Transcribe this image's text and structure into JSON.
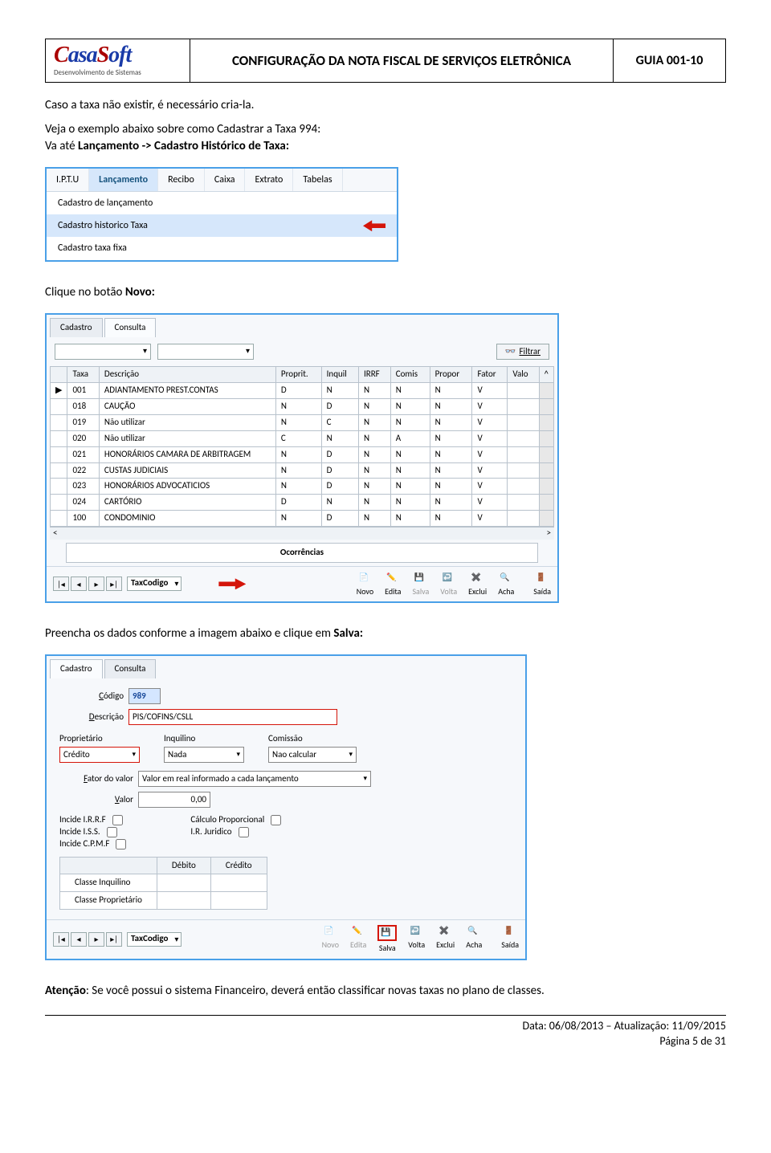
{
  "header": {
    "logo_text": "CasaSoft",
    "logo_sub": "Desenvolvimento de Sistemas",
    "title": "CONFIGURAÇÃO DA NOTA FISCAL DE SERVIÇOS ELETRÔNICA",
    "code": "GUIA 001-10"
  },
  "p1": "Caso a taxa não existir, é necessário cria-la.",
  "p2a": "Veja o exemplo abaixo sobre como Cadastrar a Taxa 994:",
  "p2b_plain": "Va até ",
  "p2b_bold": "Lançamento -> Cadastro Histórico de Taxa:",
  "menu": {
    "items": [
      "I.P.T.U",
      "Lançamento",
      "Recibo",
      "Caixa",
      "Extrato",
      "Tabelas"
    ],
    "dropdown": [
      "Cadastro de lançamento",
      "Cadastro historico Taxa",
      "Cadastro taxa fixa"
    ]
  },
  "p3_plain": "Clique no botão ",
  "p3_bold": "Novo:",
  "tabs": {
    "cadastro": "Cadastro",
    "consulta": "Consulta"
  },
  "filter_btn": "Filtrar",
  "table": {
    "headers": [
      "Taxa",
      "Descrição",
      "Proprit.",
      "Inquil",
      "IRRF",
      "Comis",
      "Propor",
      "Fator",
      "Valo"
    ],
    "rows": [
      [
        "001",
        "ADIANTAMENTO PREST.CONTAS",
        "D",
        "N",
        "N",
        "N",
        "N",
        "V",
        ""
      ],
      [
        "018",
        "CAUÇÃO",
        "N",
        "D",
        "N",
        "N",
        "N",
        "V",
        ""
      ],
      [
        "019",
        "Não utilizar",
        "N",
        "C",
        "N",
        "N",
        "N",
        "V",
        ""
      ],
      [
        "020",
        "Não utilizar",
        "C",
        "N",
        "N",
        "A",
        "N",
        "V",
        ""
      ],
      [
        "021",
        "HONORÁRIOS CAMARA DE ARBITRAGEM",
        "N",
        "D",
        "N",
        "N",
        "N",
        "V",
        ""
      ],
      [
        "022",
        "CUSTAS JUDICIAIS",
        "N",
        "D",
        "N",
        "N",
        "N",
        "V",
        ""
      ],
      [
        "023",
        "HONORÁRIOS ADVOCATICIOS",
        "N",
        "D",
        "N",
        "N",
        "N",
        "V",
        ""
      ],
      [
        "024",
        "CARTÓRIO",
        "D",
        "N",
        "N",
        "N",
        "N",
        "V",
        ""
      ],
      [
        "100",
        "CONDOMINIO",
        "N",
        "D",
        "N",
        "N",
        "N",
        "V",
        ""
      ]
    ],
    "section": "Ocorrências",
    "nav_combo": "TaxCodigo"
  },
  "toolbtns": {
    "novo": "Novo",
    "edita": "Edita",
    "salva": "Salva",
    "volta": "Volta",
    "exclui": "Exclui",
    "acha": "Acha",
    "saida": "Saída"
  },
  "p4a": "Preencha os dados conforme a imagem abaixo e clique em ",
  "p4b": "Salva:",
  "form": {
    "codigo_lbl": "Código",
    "codigo_val": "989",
    "descricao_lbl": "Descrição",
    "descricao_val": "PIS/COFINS/CSLL",
    "proprietario_lbl": "Proprietário",
    "proprietario_val": "Crédito",
    "inquilino_lbl": "Inquilino",
    "inquilino_val": "Nada",
    "comissao_lbl": "Comissão",
    "comissao_val": "Nao calcular",
    "fator_lbl": "Fator do valor",
    "fator_val": "Valor em real informado a cada lançamento",
    "valor_lbl": "Valor",
    "valor_val": "0,00",
    "irrf": "Incide I.R.R.F",
    "iss": "Incide I.S.S.",
    "cpmf": "Incide C.P.M.F",
    "calcprop": "Cálculo Proporcional",
    "irjur": "I.R. Juridico",
    "debito": "Débito",
    "credito": "Crédito",
    "classe_inq": "Classe Inquilino",
    "classe_prop": "Classe Proprietário"
  },
  "p5_bold": "Atenção",
  "p5_rest": ": Se você possui o sistema Financeiro, deverá então classificar novas taxas no plano de classes.",
  "footer": {
    "line1": "Data: 06/08/2013 – Atualização: 11/09/2015",
    "line2": "Página 5 de 31"
  }
}
